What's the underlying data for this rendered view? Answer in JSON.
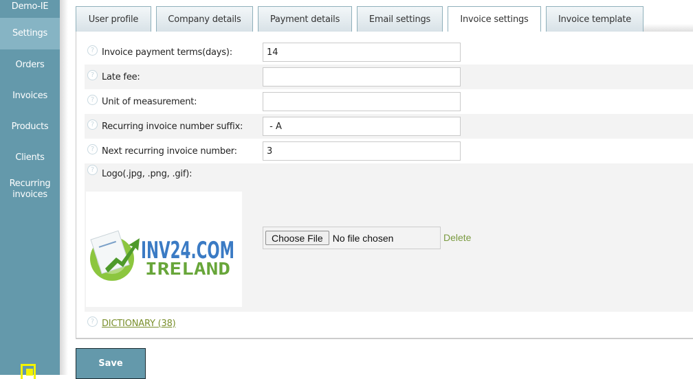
{
  "sidebar": {
    "brand": "Demo-IE",
    "items": [
      {
        "label": "Settings",
        "active": true
      },
      {
        "label": "Orders"
      },
      {
        "label": "Invoices"
      },
      {
        "label": "Products"
      },
      {
        "label": "Clients"
      },
      {
        "label": "Recurring invoices"
      }
    ],
    "exit_icon": "exit-icon"
  },
  "tabs": [
    {
      "label": "User profile"
    },
    {
      "label": "Company details"
    },
    {
      "label": "Payment details"
    },
    {
      "label": "Email settings"
    },
    {
      "label": "Invoice settings",
      "active": true
    },
    {
      "label": "Invoice template"
    }
  ],
  "form": {
    "fields": [
      {
        "label": "Invoice payment terms(days):",
        "value": "14"
      },
      {
        "label": "Late fee:",
        "value": ""
      },
      {
        "label": "Unit of measurement:",
        "value": ""
      },
      {
        "label": "Recurring invoice number suffix:",
        "value": " - A"
      },
      {
        "label": "Next recurring invoice number:",
        "value": "3"
      }
    ],
    "logo": {
      "label": "Logo(.jpg, .png, .gif):",
      "image_text_line1": "INV24.COM",
      "image_text_line2": "IRELAND",
      "choose_file_label": "Choose File",
      "file_status": "No file chosen",
      "delete_label": "Delete"
    },
    "dictionary_link": "DICTIONARY (38)",
    "help_icon_glyph": "?"
  },
  "actions": {
    "save_label": "Save"
  },
  "colors": {
    "sidebar": "#6499ab",
    "sidebar_active": "#86b4c4",
    "link_green": "#7a8f2c",
    "exit_icon": "#f3f300"
  }
}
